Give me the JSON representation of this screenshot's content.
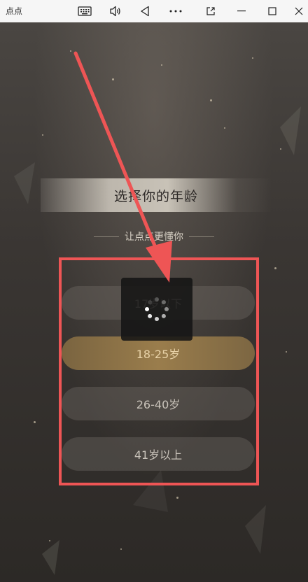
{
  "window": {
    "title": "点点",
    "icons": [
      "keyboard-icon",
      "volume-icon",
      "back-icon",
      "more-icon",
      "external-icon",
      "minimize-icon",
      "maximize-icon",
      "close-icon"
    ]
  },
  "page": {
    "title": "选择你的年龄",
    "subtitle": "让点点更懂你",
    "options": [
      {
        "label": "17岁以下",
        "selected": false
      },
      {
        "label": "18-25岁",
        "selected": true
      },
      {
        "label": "26-40岁",
        "selected": false
      },
      {
        "label": "41岁以上",
        "selected": false
      }
    ]
  },
  "colors": {
    "background": "#2f2b28",
    "selected_option": "#9a7d4c",
    "annotation": "#ee5555"
  }
}
